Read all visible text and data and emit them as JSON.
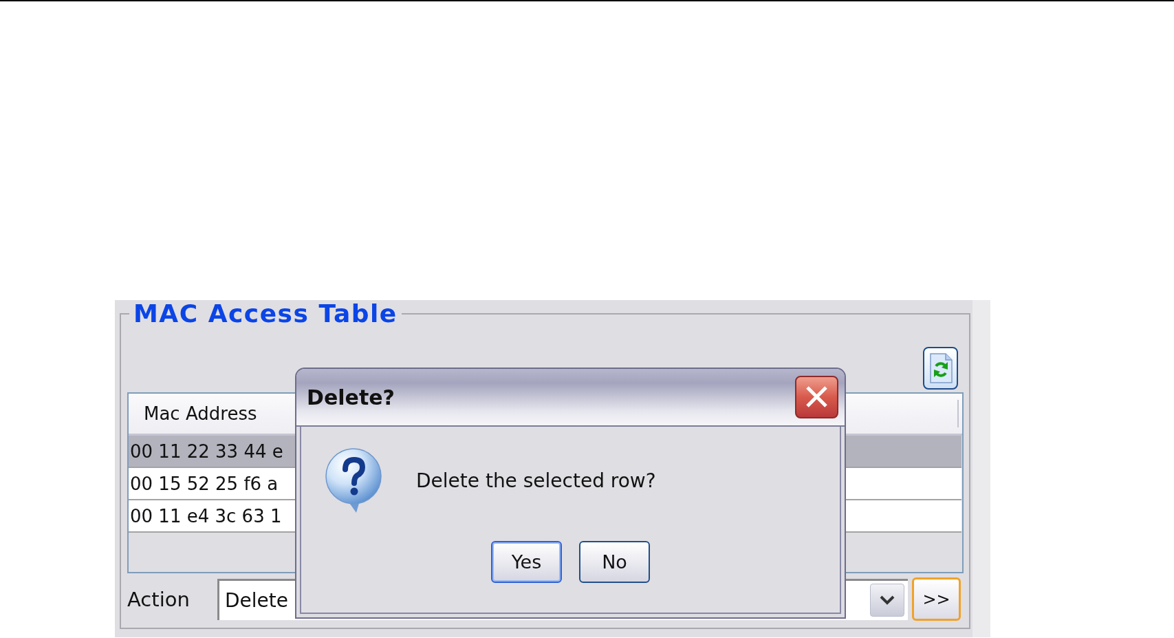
{
  "panel": {
    "title": "MAC Access Table"
  },
  "table": {
    "columns": [
      "Mac Address"
    ],
    "rows": [
      {
        "cells": [
          "00 11 22 33 44 e"
        ],
        "selected": true
      },
      {
        "cells": [
          "00 15 52 25 f6 a"
        ],
        "selected": false
      },
      {
        "cells": [
          "00 11 e4 3c 63 1"
        ],
        "selected": false
      }
    ]
  },
  "action": {
    "label": "Action",
    "value": "Delete",
    "go_button": {
      "label": ">>",
      "focused": true
    }
  },
  "dialog": {
    "title": "Delete?",
    "message": "Delete the selected row?",
    "buttons": [
      {
        "label": "Yes",
        "default": true
      },
      {
        "label": "No",
        "default": false
      }
    ]
  }
}
